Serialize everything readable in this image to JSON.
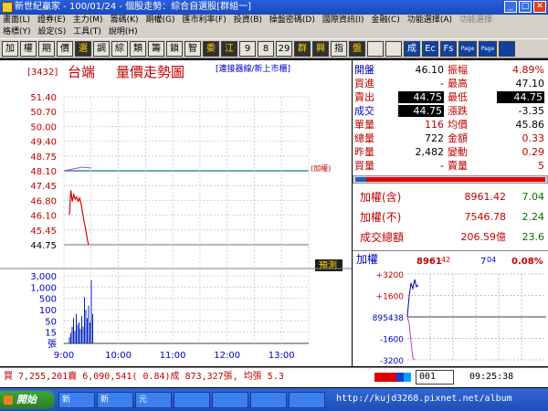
{
  "window": {
    "title": "新世紀贏家 - 100/01/24 - 個股走勢：綜合自選股[群組一]"
  },
  "menu1": [
    "畫面(L)",
    "證券(E)",
    "主力(M)",
    "籌碼(K)",
    "期權(G)",
    "匯市利率(F)",
    "投資(B)",
    "操盤密碼(D)",
    "國際資訊(I)",
    "金融(C)",
    "功能選擇(A)",
    "功能選擇"
  ],
  "menu2": [
    "格標(Y)",
    "設定(S)",
    "工具(T)",
    "說明(H)"
  ],
  "toolbar": [
    "加",
    "權",
    "期",
    "價",
    "選",
    "調",
    "綜",
    "類",
    "籌",
    "鎖",
    "智",
    "委",
    "江",
    "9",
    "8",
    "29",
    "群",
    "興",
    "指",
    "盤",
    "",
    "",
    "成",
    "Ec",
    "Fs",
    "Page",
    "Page",
    ""
  ],
  "chart": {
    "code": "[3432]",
    "name": "台端",
    "title": "量價走勢圖",
    "tag": "[連接器線/新上市櫃]",
    "ref_label": "(加權)",
    "price_ticks": [
      "51.40",
      "50.70",
      "50.00",
      "49.40",
      "48.75",
      "48.10",
      "47.45",
      "46.80",
      "46.10",
      "45.45",
      "44.75"
    ],
    "vol_ticks": [
      "3,000",
      "1,000",
      "500",
      "100",
      "50",
      "15",
      "張"
    ],
    "time_ticks": [
      "9:00",
      "10:00",
      "11:00",
      "12:00",
      "13:00"
    ],
    "badge": "預測"
  },
  "chart_data": {
    "type": "line",
    "title": "量價走勢圖",
    "xlabel": "",
    "ylabel": "",
    "ylim": [
      44.75,
      51.4
    ],
    "series": [
      {
        "name": "",
        "x": [
          "9:00",
          "9:02",
          "9:04",
          "9:06",
          "9:08",
          "9:10",
          "9:12",
          "9:14",
          "9:16",
          "9:18",
          "9:20",
          "9:22",
          "9:24",
          "9:26"
        ],
        "values": [
          46.1,
          47.2,
          46.7,
          47.0,
          46.8,
          46.9,
          46.7,
          46.85,
          46.6,
          46.2,
          45.8,
          45.5,
          45.1,
          44.75
        ]
      }
    ]
  },
  "quote": {
    "rows": [
      {
        "l": "開盤",
        "lv": "46.10",
        "r": "振幅",
        "rv": "4.89%",
        "lc": "#0000c0",
        "lvc": "#000",
        "rc": "#c00000",
        "rvc": "#c00000",
        "lhl": false,
        "rhl": false
      },
      {
        "l": "買進",
        "lv": "-",
        "r": "最高",
        "rv": "47.10",
        "lc": "#c00000",
        "lvc": "#000",
        "rc": "#c00000",
        "rvc": "#000",
        "lhl": false,
        "rhl": false
      },
      {
        "l": "賣出",
        "lv": "44.75",
        "r": "最低",
        "rv": "44.75",
        "lc": "#c00000",
        "lvc": "#fff",
        "rc": "#c00000",
        "rvc": "#fff",
        "lhl": true,
        "rhl": true
      },
      {
        "l": "成交",
        "lv": "44.75",
        "r": "漲跌",
        "rv": "-3.35",
        "lc": "#0000c0",
        "lvc": "#fff",
        "rc": "#c00000",
        "rvc": "#000",
        "lhl": true,
        "rhl": false
      },
      {
        "l": "單量",
        "lv": "116",
        "r": "均價",
        "rv": "45.86",
        "lc": "#c00000",
        "lvc": "#c00000",
        "rc": "#c00000",
        "rvc": "#000",
        "lhl": false,
        "rhl": false
      },
      {
        "l": "總量",
        "lv": "722",
        "r": "金額",
        "rv": "0.33",
        "lc": "#c00000",
        "lvc": "#000",
        "rc": "#c00000",
        "rvc": "#c00000",
        "lhl": false,
        "rhl": false
      },
      {
        "l": "昨量",
        "lv": "2,482",
        "r": "變動",
        "rv": "0.29",
        "lc": "#c00000",
        "lvc": "#000",
        "rc": "#c00000",
        "rvc": "#c00000",
        "lhl": false,
        "rhl": false
      },
      {
        "l": "買量",
        "lv": "-",
        "r": "賣量",
        "rv": "5",
        "lc": "#c00000",
        "lvc": "#000",
        "rc": "#c00000",
        "rvc": "#c00000",
        "lhl": false,
        "rhl": false
      }
    ]
  },
  "index": {
    "rows": [
      {
        "label": "加權(含)",
        "value": "8961.42",
        "change": "7.04"
      },
      {
        "label": "加權(不)",
        "value": "7546.78",
        "change": "2.24"
      },
      {
        "label": "成交總額",
        "value": "206.59億",
        "change": "23.6"
      }
    ]
  },
  "mini": {
    "title": "加權",
    "value": "8961",
    "value_small": "42",
    "change": "7",
    "change_small": "04",
    "pct": "0.08%",
    "ticks": [
      "+3200",
      "+1600",
      "895438",
      "-1600",
      "-3200"
    ]
  },
  "status": {
    "summary": "買 7,255,201賣 6,090,541( 0.84)成 873,327張, 均張 5.3",
    "field": "001",
    "clock": "09:25:38"
  },
  "taskbar": {
    "start": "開始",
    "items": [
      "新",
      "新",
      "元",
      "",
      "",
      "",
      ""
    ],
    "url": "http://kujd3268.pixnet.net/album"
  }
}
